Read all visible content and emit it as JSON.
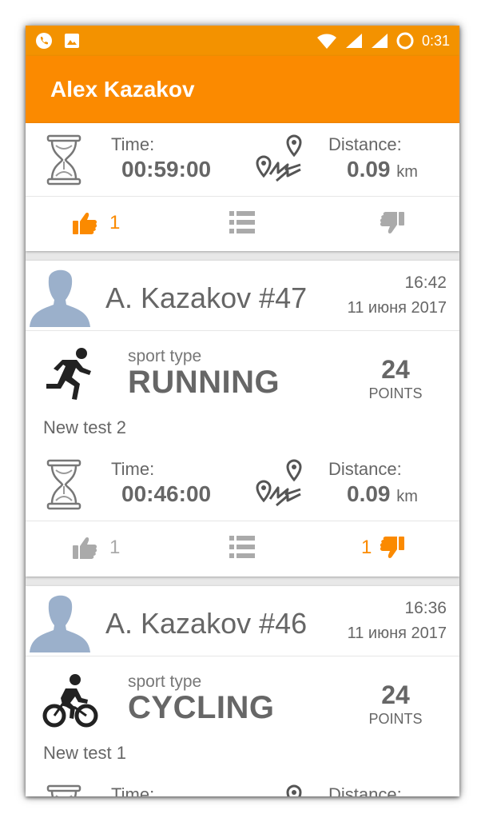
{
  "status_bar": {
    "clock": "0:31"
  },
  "app_bar": {
    "title": "Alex Kazakov"
  },
  "colors": {
    "accent": "#fb8a00",
    "status_bar": "#f39200",
    "icon_grey": "#aaaaaa",
    "avatar_blue": "#9bb0cb"
  },
  "labels": {
    "time": "Time:",
    "distance": "Distance:",
    "unit_km": "km",
    "sport_type": "sport type",
    "points": "POINTS"
  },
  "cards": [
    {
      "time_value": "00:59:00",
      "distance_value": "0.09",
      "likes": "1",
      "like_active": true,
      "dislikes": "",
      "dislike_active": false
    },
    {
      "author": "A. Kazakov #47",
      "time": "16:42",
      "date": "11 июня 2017",
      "sport_icon": "running-icon",
      "sport": "RUNNING",
      "points": "24",
      "description": "New test 2",
      "time_value": "00:46:00",
      "distance_value": "0.09",
      "likes": "1",
      "like_active": false,
      "dislikes": "1",
      "dislike_active": true
    },
    {
      "author": "A. Kazakov #46",
      "time": "16:36",
      "date": "11 июня 2017",
      "sport_icon": "cycling-icon",
      "sport": "CYCLING",
      "points": "24",
      "description": "New test 1"
    }
  ]
}
